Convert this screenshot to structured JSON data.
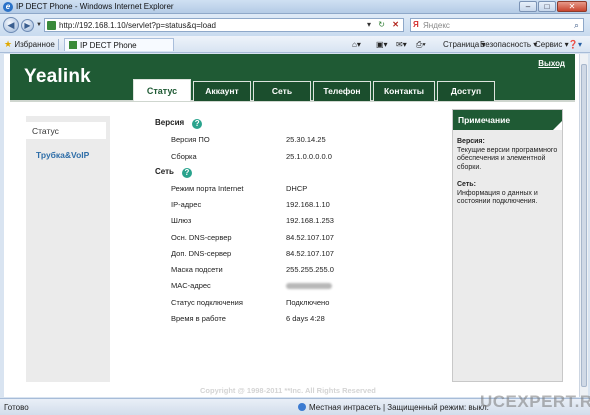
{
  "window": {
    "title": "IP DECT Phone - Windows Internet Explorer"
  },
  "browser": {
    "back_icon": "back-arrow-icon",
    "forward_icon": "forward-arrow-icon",
    "url": "http://192.168.1.10/servlet?p=status&q=load",
    "search_placeholder": "Яндекс",
    "favorites_label": "Избранное",
    "tab_title": "IP DECT Phone",
    "commands": {
      "page": "Страница",
      "safety": "Безопасность",
      "tools": "Сервис"
    }
  },
  "header": {
    "logo": "Yealink",
    "logout": "Выход",
    "tabs": [
      "Статус",
      "Аккаунт",
      "Сеть",
      "Телефон",
      "Контакты",
      "Доступ"
    ],
    "active_tab": "Статус"
  },
  "sidebar": {
    "items": [
      "Статус",
      "Трубка&VoIP"
    ]
  },
  "status": {
    "version_title": "Версия",
    "version_rows": [
      {
        "label": "Версия ПО",
        "value": "25.30.14.25"
      },
      {
        "label": "Сборка",
        "value": "25.1.0.0.0.0.0"
      }
    ],
    "network_title": "Сеть",
    "network_rows": [
      {
        "label": "Режим порта Internet",
        "value": "DHCP"
      },
      {
        "label": "IP-адрес",
        "value": "192.168.1.10"
      },
      {
        "label": "Шлюз",
        "value": "192.168.1.253"
      },
      {
        "label": "Осн. DNS-сервер",
        "value": "84.52.107.107"
      },
      {
        "label": "Доп. DNS-сервер",
        "value": "84.52.107.107"
      },
      {
        "label": "Маска подсети",
        "value": "255.255.255.0"
      },
      {
        "label": "MAC-адрес",
        "value": ""
      },
      {
        "label": "Статус подключения",
        "value": "Подключено"
      },
      {
        "label": "Время в работе",
        "value": "6 days 4:28"
      }
    ]
  },
  "note": {
    "title": "Примечание",
    "version_title": "Версия:",
    "version_text": "Текущие версии программного обеспечения и элементной сборки.",
    "network_title": "Сеть:",
    "network_text": "Информация о данных и состоянии подключения."
  },
  "footer": {
    "copyright": "Copyright @ 1998-2011 **Inc. All Rights Reserved"
  },
  "statusbar": {
    "status": "Готово",
    "zone": "Местная интрасеть | Защищенный режим: выкл.",
    "watermark": "UCEXPERT.RU"
  }
}
